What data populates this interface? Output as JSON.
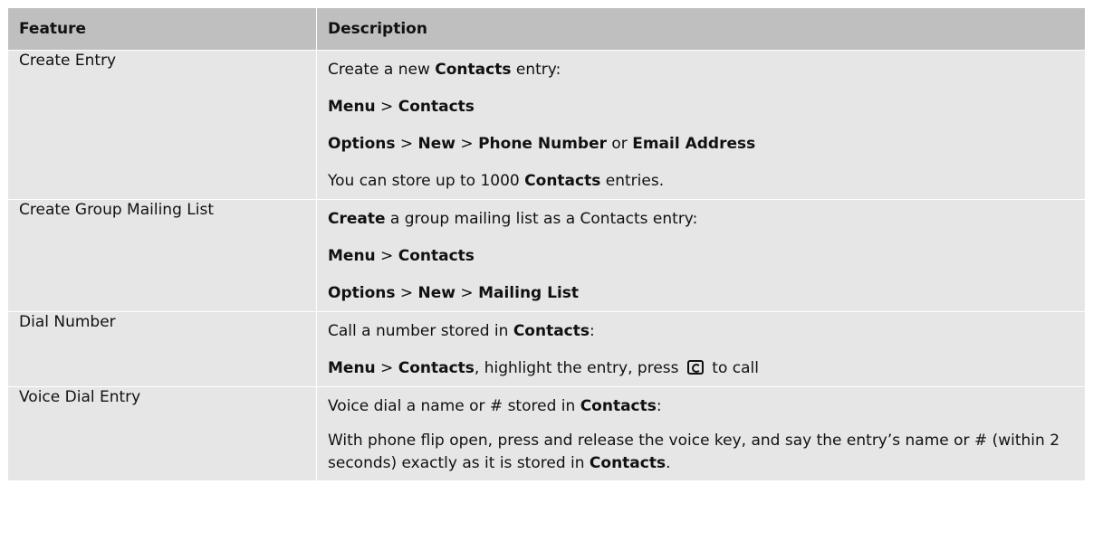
{
  "headers": {
    "feature": "Feature",
    "description": "Description"
  },
  "rows": [
    {
      "feature": "Create Entry",
      "lines": [
        [
          {
            "t": "Create a new ",
            "b": false
          },
          {
            "t": "Contacts",
            "b": true
          },
          {
            "t": " entry:",
            "b": false
          }
        ],
        [
          {
            "t": "Menu",
            "b": true
          },
          {
            "t": " > ",
            "b": false
          },
          {
            "t": "Contacts",
            "b": true
          }
        ],
        [
          {
            "t": "Options",
            "b": true
          },
          {
            "t": " > ",
            "b": false
          },
          {
            "t": "New",
            "b": true
          },
          {
            "t": " > ",
            "b": false
          },
          {
            "t": "Phone Number",
            "b": true
          },
          {
            "t": " or ",
            "b": false
          },
          {
            "t": "Email Address",
            "b": true
          }
        ],
        [
          {
            "t": "You can store up to 1000 ",
            "b": false
          },
          {
            "t": "Contacts",
            "b": true
          },
          {
            "t": " entries.",
            "b": false
          }
        ]
      ]
    },
    {
      "feature": "Create Group Mailing List",
      "lines": [
        [
          {
            "t": "Create",
            "b": true
          },
          {
            "t": " a group mailing list as a Contacts entry:",
            "b": false
          }
        ],
        [
          {
            "t": "Menu",
            "b": true
          },
          {
            "t": " > ",
            "b": false
          },
          {
            "t": "Contacts",
            "b": true
          }
        ],
        [
          {
            "t": "Options",
            "b": true
          },
          {
            "t": " > ",
            "b": false
          },
          {
            "t": "New",
            "b": true
          },
          {
            "t": " > ",
            "b": false
          },
          {
            "t": "Mailing List",
            "b": true
          }
        ]
      ]
    },
    {
      "feature": "Dial Number",
      "lines": [
        [
          {
            "t": "Call a number stored in ",
            "b": false
          },
          {
            "t": "Contacts",
            "b": true
          },
          {
            "t": ":",
            "b": false
          }
        ],
        [
          {
            "t": "Menu",
            "b": true
          },
          {
            "t": " > ",
            "b": false
          },
          {
            "t": "Contacts",
            "b": true
          },
          {
            "t": ", highlight the entry, press ",
            "b": false
          },
          {
            "icon": "send-key-icon"
          },
          {
            "t": " to call",
            "b": false
          }
        ]
      ]
    },
    {
      "feature": "Voice Dial Entry",
      "lines": [
        [
          {
            "t": "Voice dial a name or # stored in ",
            "b": false
          },
          {
            "t": "Contacts",
            "b": true
          },
          {
            "t": ":",
            "b": false
          }
        ],
        [
          {
            "t": "With phone flip open, press and release the voice key, and say the entry’s name or # (within 2 seconds) exactly as it is stored in ",
            "b": false
          },
          {
            "t": "Contacts",
            "b": true
          },
          {
            "t": ".",
            "b": false
          }
        ]
      ]
    }
  ]
}
